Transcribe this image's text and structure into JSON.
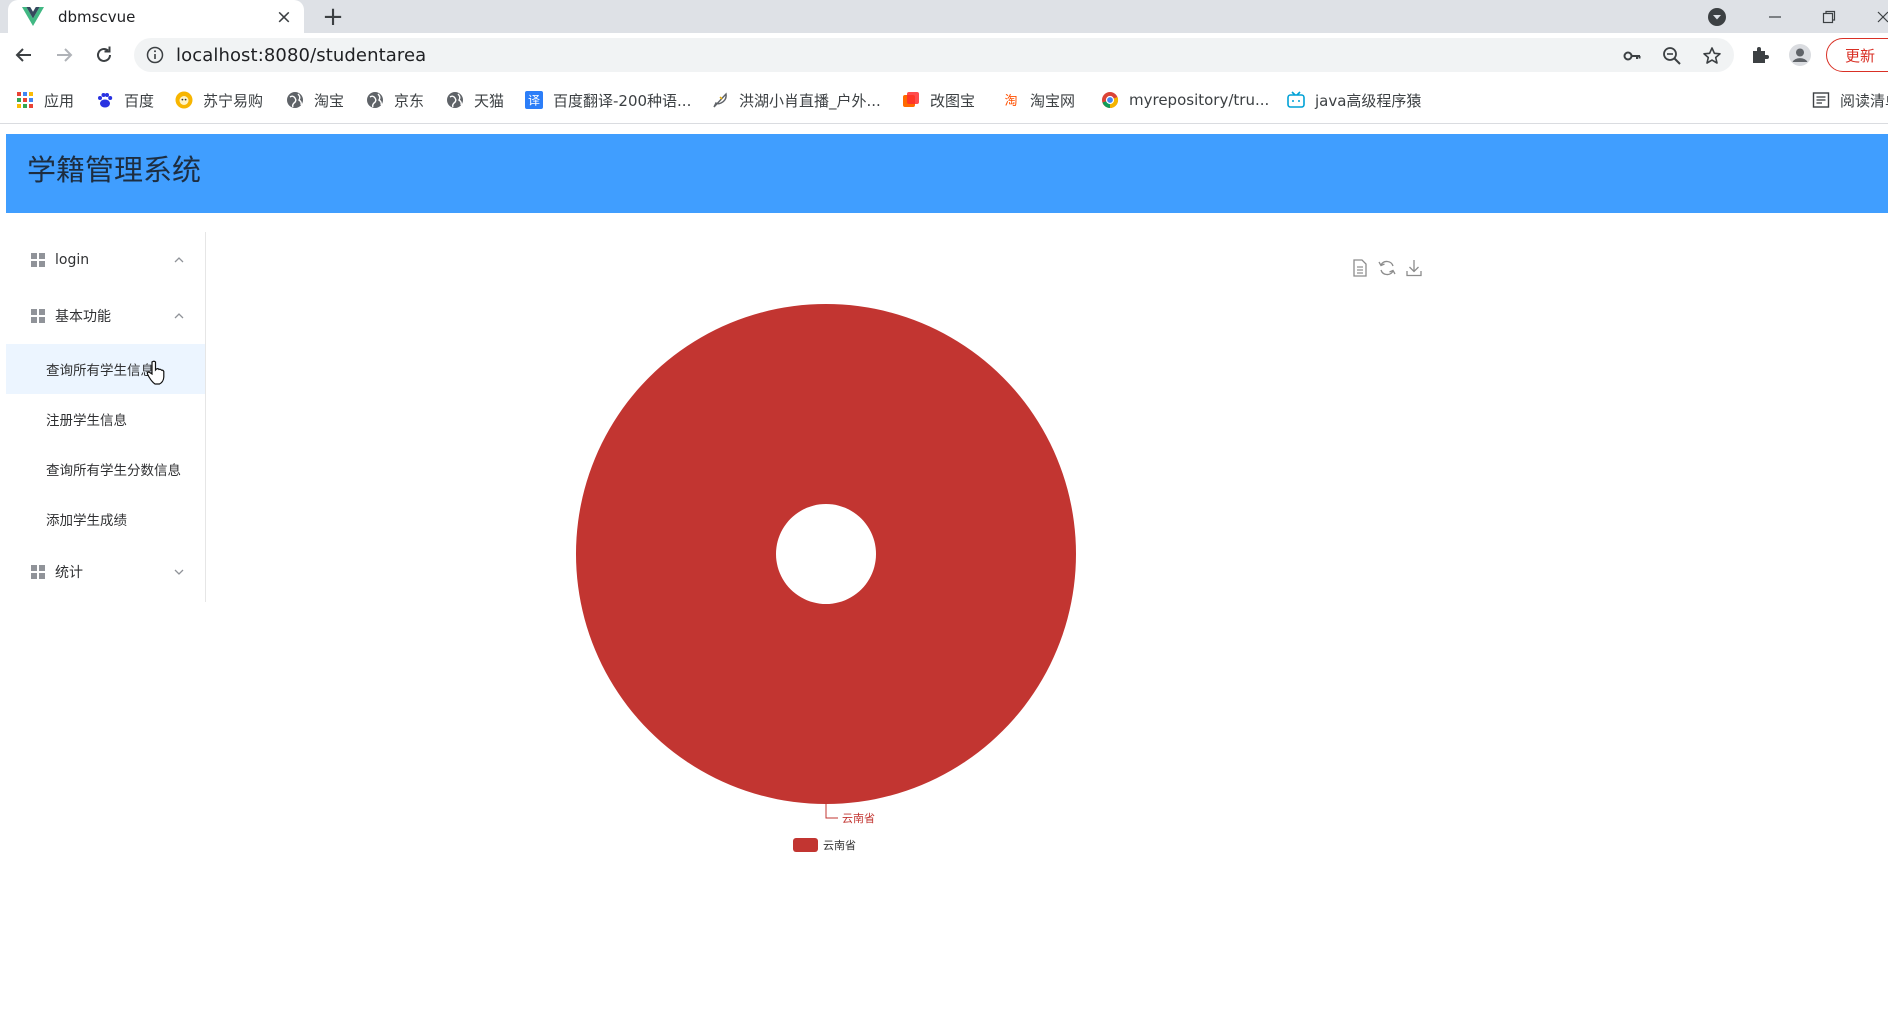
{
  "browser": {
    "tab_title": "dbmscvue",
    "url": "localhost:8080/studentarea",
    "update_label": "更新",
    "bookmarks": [
      "应用",
      "百度",
      "苏宁易购",
      "淘宝",
      "京东",
      "天猫",
      "百度翻译-200种语...",
      "洪湖小肖直播_户外...",
      "改图宝",
      "淘宝网",
      "myrepository/tru...",
      "java高级程序猿"
    ],
    "reading_list": "阅读清单"
  },
  "app": {
    "title": "学籍管理系统"
  },
  "sidebar": {
    "groups": [
      {
        "label": "login",
        "expanded": true
      },
      {
        "label": "基本功能",
        "expanded": true
      },
      {
        "label": "统计",
        "expanded": false
      }
    ],
    "items": [
      "查询所有学生信息",
      "注册学生信息",
      "查询所有学生分数信息",
      "添加学生成绩"
    ]
  },
  "chart_data": {
    "type": "pie",
    "donut": true,
    "labels": [
      "云南省"
    ],
    "values": [
      1
    ],
    "colors": [
      "#c23531"
    ],
    "legend": [
      "云南省"
    ],
    "legend_position": "bottom",
    "toolbox": [
      "data-view-icon",
      "restore-icon",
      "save-image-icon"
    ]
  }
}
